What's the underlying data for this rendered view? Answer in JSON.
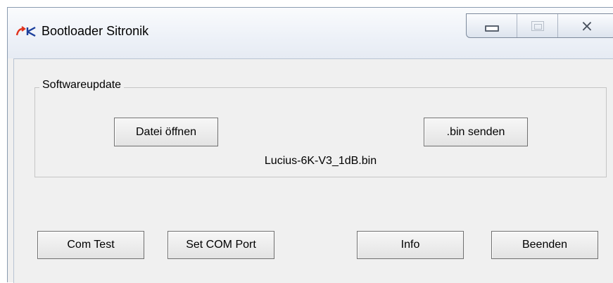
{
  "window": {
    "title": "Bootloader Sitronik",
    "icon": "app-arrow-icon",
    "controls": {
      "minimize_icon": "minimize-icon",
      "maximize_icon": "maximize-icon",
      "close_label": "⨯"
    }
  },
  "group": {
    "label": "Softwareupdate",
    "open_file_label": "Datei öffnen",
    "send_bin_label": ".bin senden",
    "file_name": "Lucius-6K-V3_1dB.bin"
  },
  "footer": {
    "com_test_label": "Com Test",
    "set_com_port_label": "Set COM Port",
    "info_label": "Info",
    "exit_label": "Beenden"
  }
}
